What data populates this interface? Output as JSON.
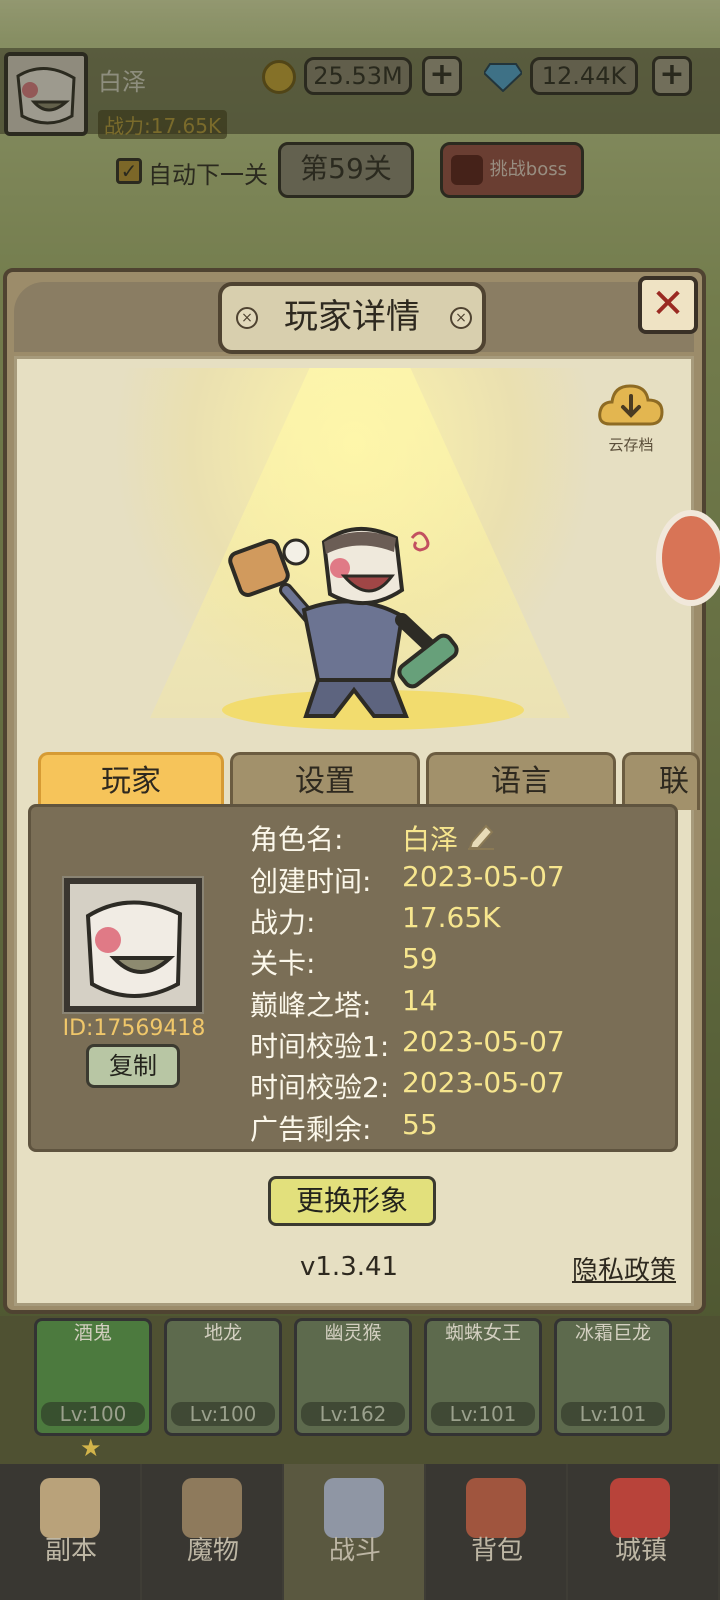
{
  "hud": {
    "player_name": "白泽",
    "power_label": "战力:17.65K",
    "gold": "25.53M",
    "gems": "12.44K",
    "plus": "+",
    "auto_next_label": "自动下一关",
    "auto_next_checked": true,
    "stage_label": "第59关",
    "boss_button": "挑战boss"
  },
  "modal": {
    "title": "玩家详情",
    "close": "✕",
    "cloud_save_label": "云存档",
    "tabs": [
      "玩家",
      "设置",
      "语言",
      "联"
    ],
    "active_tab": 0,
    "player_id": "ID:17569418",
    "copy_button": "复制",
    "fields": [
      {
        "key": "角色名:",
        "value": "白泽"
      },
      {
        "key": "创建时间:",
        "value": "2023-05-07"
      },
      {
        "key": "战力:",
        "value": "17.65K"
      },
      {
        "key": "关卡:",
        "value": "59"
      },
      {
        "key": "巅峰之塔:",
        "value": "14"
      },
      {
        "key": "时间校验1:",
        "value": "2023-05-07"
      },
      {
        "key": "时间校验2:",
        "value": "2023-05-07"
      },
      {
        "key": "广告剩余:",
        "value": "55"
      }
    ],
    "change_avatar_button": "更换形象",
    "version": "v1.3.41",
    "privacy_link": "隐私政策"
  },
  "roster": [
    {
      "name": "酒鬼",
      "level": "Lv:100"
    },
    {
      "name": "地龙",
      "level": "Lv:100"
    },
    {
      "name": "幽灵猴",
      "level": "Lv:162"
    },
    {
      "name": "蜘蛛女王",
      "level": "Lv:101"
    },
    {
      "name": "冰霜巨龙",
      "level": "Lv:101"
    }
  ],
  "nav": {
    "items": [
      "副本",
      "魔物",
      "战斗",
      "背包",
      "城镇"
    ],
    "active": 2
  },
  "colors": {
    "active_tab": "#f6c45a",
    "value_text": "#f7e68e",
    "id_text": "#f0c76a",
    "close_x": "#9a2a22"
  },
  "icons": [
    "coin-icon",
    "gem-icon",
    "checkbox-icon",
    "boss-icon",
    "bolt-icon",
    "close-icon",
    "cloud-download-icon",
    "edit-pencil-icon",
    "star-icon",
    "map-icon",
    "monster-icon",
    "swords-icon",
    "backpack-icon",
    "castle-icon"
  ]
}
